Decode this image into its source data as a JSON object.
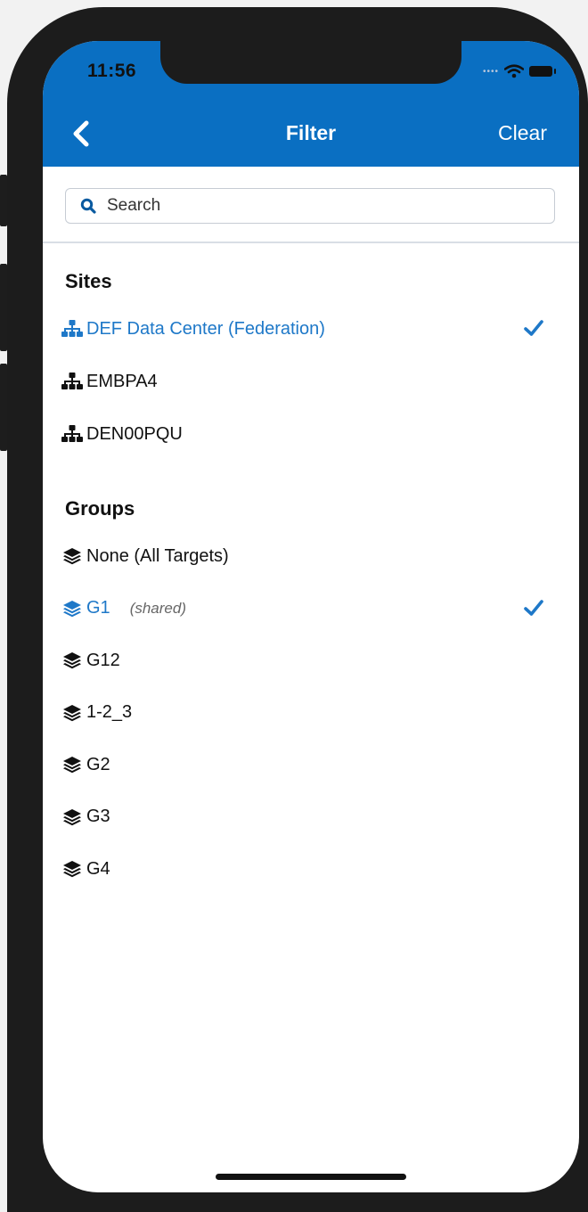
{
  "status_bar": {
    "time": "11:56"
  },
  "nav": {
    "title": "Filter",
    "clear_label": "Clear"
  },
  "search": {
    "placeholder": "Search",
    "value": ""
  },
  "sites": {
    "title": "Sites",
    "items": [
      {
        "label": "DEF Data Center (Federation)",
        "selected": true
      },
      {
        "label": "EMBPA4",
        "selected": false
      },
      {
        "label": "DEN00PQU",
        "selected": false
      }
    ]
  },
  "groups": {
    "title": "Groups",
    "items": [
      {
        "label": "None (All Targets)",
        "note": "",
        "selected": false
      },
      {
        "label": "G1",
        "note": "(shared)",
        "selected": true
      },
      {
        "label": "G12",
        "note": "",
        "selected": false
      },
      {
        "label": "1-2_3",
        "note": "",
        "selected": false
      },
      {
        "label": "G2",
        "note": "",
        "selected": false
      },
      {
        "label": "G3",
        "note": "",
        "selected": false
      },
      {
        "label": "G4",
        "note": "",
        "selected": false
      }
    ]
  },
  "colors": {
    "header": "#0a6fc2",
    "accent": "#1e78c8",
    "text": "#111111"
  },
  "icons": {
    "site": "sitemap-icon",
    "group": "layers-icon",
    "selected": "checkmark-icon"
  }
}
